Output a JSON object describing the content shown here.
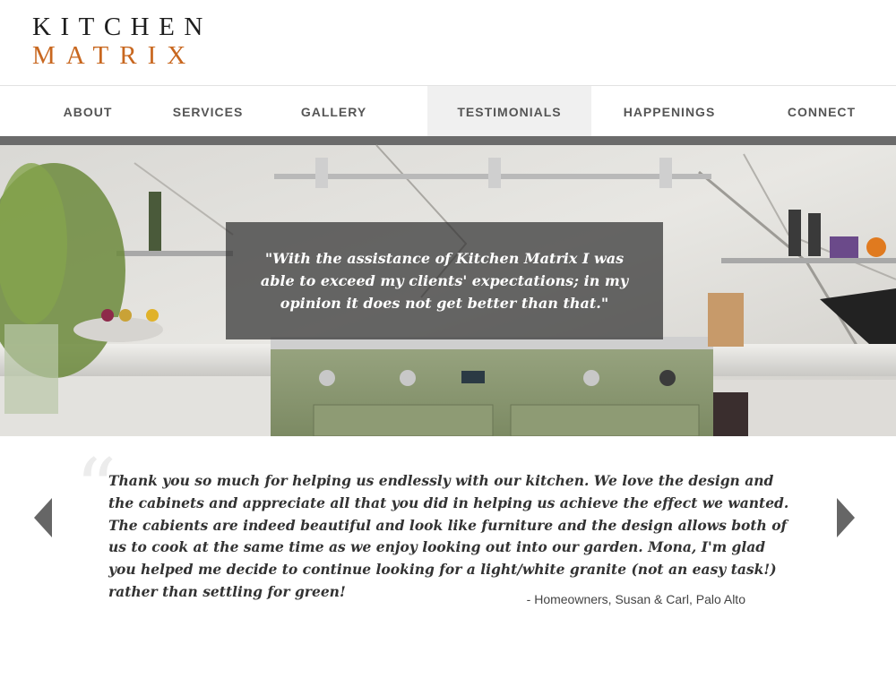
{
  "logo": {
    "line1": "KITCHEN",
    "line2": "MATRIX",
    "brand_color": "#c8671f"
  },
  "nav": {
    "items": [
      {
        "label": "ABOUT",
        "active": false
      },
      {
        "label": "SERVICES",
        "active": false
      },
      {
        "label": "GALLERY",
        "active": false
      },
      {
        "label": "TESTIMONIALS",
        "active": true
      },
      {
        "label": "HAPPENINGS",
        "active": false
      },
      {
        "label": "CONNECT",
        "active": false
      }
    ]
  },
  "hero": {
    "quote": "\"With the assistance of Kitchen Matrix I was able to exceed my clients' expectations; in my opinion it does not get better than that.\""
  },
  "testimonial": {
    "open_quote_glyph": "“",
    "text": "Thank you so much for helping us endlessly with our kitchen. We love the design and the cabinets and appreciate all that you did in helping us achieve the effect we wanted. The cabients are indeed beautiful and look like furniture and the design allows both of us to cook at the same time as we enjoy looking out into our garden. Mona, I'm glad you helped me decide to continue looking for a light/white granite (not an easy task!) rather than settling for green!",
    "attribution": "- Homeowners, Susan & Carl, Palo Alto",
    "prev_icon": "chevron-left-icon",
    "next_icon": "chevron-right-icon"
  }
}
